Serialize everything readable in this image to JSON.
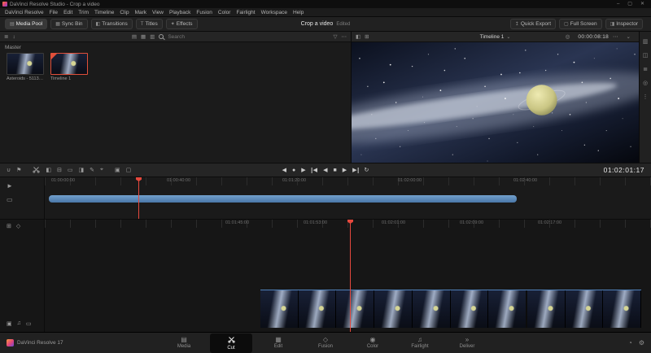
{
  "title_bar": {
    "title": "DaVinci Resolve Studio - Crop a video"
  },
  "window": {
    "minimize": "–",
    "maximize": "▢",
    "close": "✕"
  },
  "menu": {
    "items": [
      "DaVinci Resolve",
      "File",
      "Edit",
      "Trim",
      "Timeline",
      "Clip",
      "Mark",
      "View",
      "Playback",
      "Fusion",
      "Color",
      "Fairlight",
      "Workspace",
      "Help"
    ]
  },
  "toolbar": {
    "media_pool": "Media Pool",
    "sync_bin": "Sync Bin",
    "transitions": "Transitions",
    "titles": "Titles",
    "effects": "Effects",
    "project_title": "Crop a video",
    "project_status": "Edited",
    "quick_export": "Quick Export",
    "full_screen": "Full Screen",
    "inspector": "Inspector"
  },
  "media_pool": {
    "bin_label": "Master",
    "search_placeholder": "Search",
    "clips": [
      {
        "name": "Asteroids - 51135..."
      },
      {
        "name": "Timeline 1"
      }
    ]
  },
  "viewer": {
    "timeline_selector": "Timeline 1",
    "timecode": "00:00:08:18"
  },
  "transport": {
    "timecode": "01:02:01:17"
  },
  "timeline_overview": {
    "ruler": [
      "01:00:00:00",
      "01:00:40:00",
      "01:01:20:00",
      "01:02:00:00",
      "01:02:40:00"
    ]
  },
  "timeline_detail": {
    "ruler": [
      "01:01:45:00",
      "01:01:53:00",
      "01:02:01:00",
      "01:02:09:00",
      "01:02:17:00"
    ]
  },
  "bottom_bar": {
    "app_label": "DaVinci Resolve 17",
    "tabs": [
      {
        "label": "Media"
      },
      {
        "label": "Cut"
      },
      {
        "label": "Edit"
      },
      {
        "label": "Fusion"
      },
      {
        "label": "Color"
      },
      {
        "label": "Fairlight"
      },
      {
        "label": "Deliver"
      }
    ]
  },
  "colors": {
    "accent_red": "#e5483d",
    "timeline_blue": "#5a87b5",
    "selection_red": "#e04f3a"
  }
}
